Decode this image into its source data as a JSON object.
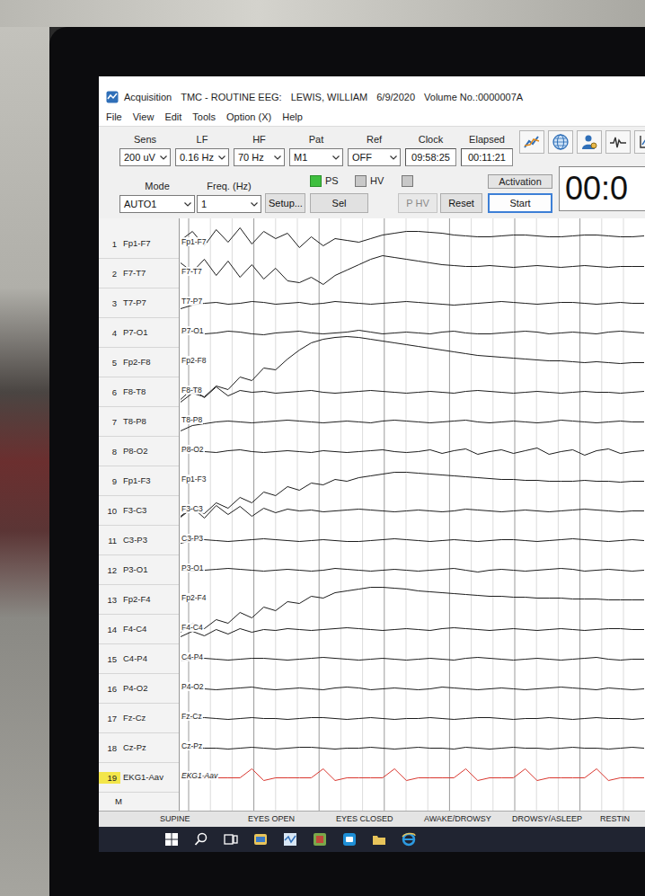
{
  "window": {
    "title_parts": [
      "Acquisition",
      "TMC - ROUTINE EEG:",
      "LEWIS, WILLIAM",
      "6/9/2020",
      "Volume No.:0000007A"
    ]
  },
  "menu": [
    "File",
    "View",
    "Edit",
    "Tools",
    "Option (X)",
    "Help"
  ],
  "settings": [
    {
      "label": "Sens",
      "value": "200 uV"
    },
    {
      "label": "LF",
      "value": "0.16 Hz"
    },
    {
      "label": "HF",
      "value": "70 Hz"
    },
    {
      "label": "Pat",
      "value": "M1"
    },
    {
      "label": "Ref",
      "value": "OFF"
    }
  ],
  "clock": {
    "label": "Clock",
    "value": "09:58:25"
  },
  "elapsed": {
    "label": "Elapsed",
    "value": "00:11:21"
  },
  "mode": {
    "label": "Mode",
    "value": "AUTO1"
  },
  "freq": {
    "label": "Freq. (Hz)",
    "value": "1"
  },
  "setup_button": "Setup...",
  "checks": [
    {
      "label": "PS",
      "checked": true
    },
    {
      "label": "HV",
      "checked": false
    },
    {
      "checked": false
    }
  ],
  "buttons": [
    {
      "label": "Sel",
      "disabled": false
    },
    {
      "label": "P HV",
      "disabled": true
    },
    {
      "label": "Reset",
      "disabled": false
    }
  ],
  "activation": {
    "label": "Activation",
    "button": "Start"
  },
  "timer": "00:0",
  "channels": [
    {
      "number": "1",
      "name": "Fp1-F7",
      "selected": false,
      "color": "#1c1c1c",
      "values": [
        4,
        14,
        -2,
        16,
        2,
        18,
        0,
        14,
        6,
        12,
        -4,
        8,
        -2,
        6,
        4,
        2,
        6,
        10,
        12,
        14,
        14,
        13,
        12,
        10,
        9,
        8,
        8,
        9,
        10,
        10,
        9,
        8,
        8,
        9,
        10,
        10,
        9,
        8,
        8,
        9
      ]
    },
    {
      "number": "2",
      "name": "F7-T7",
      "selected": false,
      "color": "#1c1c1c",
      "values": [
        12,
        2,
        16,
        -2,
        14,
        -4,
        10,
        -6,
        6,
        -8,
        -10,
        -4,
        -12,
        -2,
        4,
        10,
        16,
        20,
        18,
        16,
        14,
        12,
        10,
        9,
        8,
        8,
        9,
        8,
        7,
        8,
        9,
        8,
        7,
        8,
        9,
        8,
        7,
        8,
        8,
        8
      ]
    },
    {
      "number": "3",
      "name": "T7-P7",
      "selected": false,
      "color": "#1c1c1c",
      "values": [
        -6,
        -2,
        0,
        1,
        -1,
        0,
        2,
        1,
        -1,
        0,
        1,
        -1,
        0,
        2,
        1,
        0,
        -1,
        0,
        1,
        2,
        1,
        0,
        -1,
        -2,
        -1,
        0,
        1,
        2,
        1,
        0,
        -1,
        0,
        1,
        1,
        0,
        -1,
        0,
        1,
        0,
        0
      ]
    },
    {
      "number": "4",
      "name": "P7-O1",
      "selected": false,
      "color": "#1c1c1c",
      "values": [
        0,
        1,
        -1,
        0,
        2,
        1,
        -1,
        -2,
        0,
        1,
        2,
        0,
        -1,
        0,
        1,
        3,
        1,
        -1,
        0,
        1,
        0,
        -1,
        1,
        2,
        0,
        -1,
        -1,
        0,
        1,
        2,
        1,
        -1,
        0,
        1,
        0,
        -1,
        1,
        2,
        1,
        0
      ]
    },
    {
      "number": "5",
      "name": "Fp2-F8",
      "selected": false,
      "color": "#1c1c1c",
      "values": [
        -44,
        -34,
        -38,
        -26,
        -30,
        -16,
        -20,
        -6,
        -8,
        4,
        14,
        22,
        26,
        28,
        29,
        28,
        26,
        24,
        22,
        20,
        18,
        16,
        14,
        12,
        10,
        8,
        7,
        6,
        5,
        4,
        3,
        2,
        2,
        1,
        0,
        1,
        0,
        -1,
        0,
        0
      ]
    },
    {
      "number": "6",
      "name": "F8-T8",
      "selected": false,
      "color": "#1c1c1c",
      "values": [
        -8,
        4,
        -6,
        6,
        -4,
        2,
        0,
        1,
        -1,
        0,
        1,
        2,
        0,
        -1,
        0,
        1,
        2,
        1,
        0,
        -1,
        0,
        1,
        0,
        -1,
        1,
        2,
        1,
        0,
        -1,
        0,
        1,
        0,
        -1,
        0,
        1,
        0,
        0,
        -1,
        0,
        1
      ]
    },
    {
      "number": "7",
      "name": "T8-P8",
      "selected": false,
      "color": "#1c1c1c",
      "values": [
        -10,
        -4,
        -2,
        0,
        1,
        0,
        -1,
        0,
        1,
        2,
        1,
        0,
        -1,
        0,
        1,
        0,
        -1,
        1,
        2,
        1,
        0,
        -1,
        0,
        1,
        2,
        0,
        -1,
        0,
        1,
        0,
        -1,
        0,
        2,
        1,
        0,
        -1,
        0,
        1,
        0,
        0
      ]
    },
    {
      "number": "8",
      "name": "P8-O2",
      "selected": false,
      "color": "#1c1c1c",
      "values": [
        0,
        1,
        0,
        -1,
        1,
        2,
        0,
        -1,
        0,
        1,
        0,
        -1,
        1,
        0,
        -1,
        0,
        1,
        2,
        0,
        -1,
        0,
        2,
        -2,
        1,
        3,
        -3,
        0,
        2,
        -2,
        1,
        4,
        -3,
        0,
        2,
        -4,
        1,
        3,
        -2,
        0,
        1
      ]
    },
    {
      "number": "9",
      "name": "Fp1-F3",
      "selected": false,
      "color": "#1c1c1c",
      "values": [
        -40,
        -30,
        -36,
        -24,
        -30,
        -18,
        -24,
        -12,
        -16,
        -6,
        -10,
        -2,
        -4,
        2,
        0,
        4,
        6,
        8,
        10,
        10,
        9,
        8,
        7,
        6,
        5,
        4,
        3,
        2,
        2,
        1,
        1,
        0,
        0,
        0,
        1,
        0,
        0,
        -1,
        0,
        0
      ]
    },
    {
      "number": "10",
      "name": "F3-C3",
      "selected": false,
      "color": "#1c1c1c",
      "values": [
        -6,
        4,
        -8,
        6,
        -4,
        5,
        -6,
        3,
        -2,
        2,
        0,
        1,
        -1,
        0,
        1,
        2,
        1,
        0,
        -1,
        0,
        1,
        0,
        -1,
        0,
        2,
        1,
        0,
        -1,
        0,
        1,
        0,
        -1,
        0,
        1,
        2,
        1,
        0,
        -1,
        0,
        0
      ]
    },
    {
      "number": "11",
      "name": "C3-P3",
      "selected": false,
      "color": "#1c1c1c",
      "values": [
        -3,
        0,
        1,
        0,
        -1,
        0,
        1,
        2,
        1,
        0,
        -1,
        0,
        1,
        0,
        -1,
        -1,
        0,
        1,
        2,
        1,
        0,
        -1,
        0,
        1,
        0,
        -1,
        0,
        1,
        1,
        0,
        -1,
        0,
        1,
        2,
        1,
        0,
        -1,
        0,
        1,
        0
      ]
    },
    {
      "number": "12",
      "name": "P3-O1",
      "selected": false,
      "color": "#1c1c1c",
      "values": [
        0,
        -1,
        0,
        1,
        2,
        1,
        0,
        -1,
        0,
        1,
        0,
        -1,
        0,
        2,
        1,
        0,
        -1,
        0,
        1,
        0,
        -1,
        0,
        1,
        2,
        0,
        -2,
        0,
        1,
        0,
        -1,
        0,
        1,
        2,
        1,
        -1,
        0,
        1,
        0,
        -1,
        0
      ]
    },
    {
      "number": "13",
      "name": "Fp2-F4",
      "selected": false,
      "color": "#1c1c1c",
      "values": [
        -36,
        -26,
        -32,
        -22,
        -26,
        -14,
        -20,
        -8,
        -12,
        -2,
        -4,
        4,
        2,
        8,
        10,
        12,
        14,
        14,
        13,
        12,
        10,
        9,
        8,
        7,
        6,
        5,
        4,
        4,
        3,
        3,
        2,
        2,
        2,
        1,
        1,
        1,
        0,
        0,
        0,
        0
      ]
    },
    {
      "number": "14",
      "name": "F4-C4",
      "selected": false,
      "color": "#1c1c1c",
      "values": [
        -8,
        -2,
        -7,
        0,
        -5,
        1,
        -3,
        0,
        -1,
        1,
        0,
        -1,
        0,
        1,
        2,
        1,
        0,
        -1,
        0,
        1,
        0,
        -1,
        1,
        2,
        1,
        0,
        -1,
        0,
        1,
        0,
        -1,
        0,
        1,
        0,
        -1,
        0,
        1,
        1,
        0,
        0
      ]
    },
    {
      "number": "15",
      "name": "C4-P4",
      "selected": false,
      "color": "#1c1c1c",
      "values": [
        -2,
        0,
        1,
        0,
        -1,
        0,
        1,
        1,
        0,
        -1,
        0,
        1,
        2,
        1,
        0,
        -1,
        0,
        1,
        0,
        -1,
        0,
        1,
        0,
        -1,
        1,
        2,
        1,
        0,
        -1,
        0,
        1,
        0,
        -1,
        0,
        1,
        2,
        0,
        -1,
        0,
        0
      ]
    },
    {
      "number": "16",
      "name": "P4-O2",
      "selected": false,
      "color": "#1c1c1c",
      "values": [
        0,
        1,
        0,
        -1,
        0,
        1,
        2,
        0,
        -1,
        0,
        1,
        0,
        -1,
        1,
        2,
        1,
        -1,
        0,
        1,
        0,
        -1,
        0,
        2,
        1,
        0,
        -1,
        0,
        1,
        0,
        -1,
        0,
        1,
        2,
        1,
        0,
        -1,
        1,
        0,
        -1,
        0
      ]
    },
    {
      "number": "17",
      "name": "Fz-Cz",
      "selected": false,
      "color": "#1c1c1c",
      "values": [
        0,
        0,
        1,
        0,
        -1,
        0,
        1,
        0,
        0,
        -1,
        0,
        1,
        1,
        0,
        -1,
        0,
        1,
        0,
        -1,
        0,
        0,
        1,
        0,
        -1,
        0,
        1,
        1,
        0,
        -1,
        0,
        0,
        1,
        0,
        -1,
        0,
        1,
        0,
        0,
        -1,
        0
      ]
    },
    {
      "number": "18",
      "name": "Cz-Pz",
      "selected": false,
      "color": "#1c1c1c",
      "values": [
        0,
        1,
        0,
        0,
        -1,
        0,
        1,
        0,
        -1,
        0,
        1,
        1,
        0,
        -1,
        0,
        0,
        1,
        0,
        -1,
        0,
        1,
        0,
        0,
        -1,
        1,
        0,
        -1,
        0,
        1,
        0,
        0,
        -1,
        0,
        1,
        0,
        0,
        -1,
        0,
        1,
        0
      ]
    },
    {
      "number": "19",
      "name": "EKG1-Aav",
      "selected": true,
      "color": "#d9372f",
      "values": [
        0,
        0,
        0,
        0,
        0,
        0,
        10,
        -3,
        0,
        0,
        0,
        0,
        10,
        -3,
        0,
        0,
        0,
        0,
        10,
        -3,
        0,
        0,
        0,
        0,
        10,
        -3,
        0,
        0,
        0,
        10,
        -3,
        0,
        0,
        0,
        0,
        10,
        -3,
        0,
        0,
        0
      ]
    }
  ],
  "marker_row": "M",
  "annotations": [
    "SUPINE",
    "EYES OPEN",
    "EYES CLOSED",
    "AWAKE/DROWSY",
    "DROWSY/ASLEEP",
    "RESTIN"
  ]
}
